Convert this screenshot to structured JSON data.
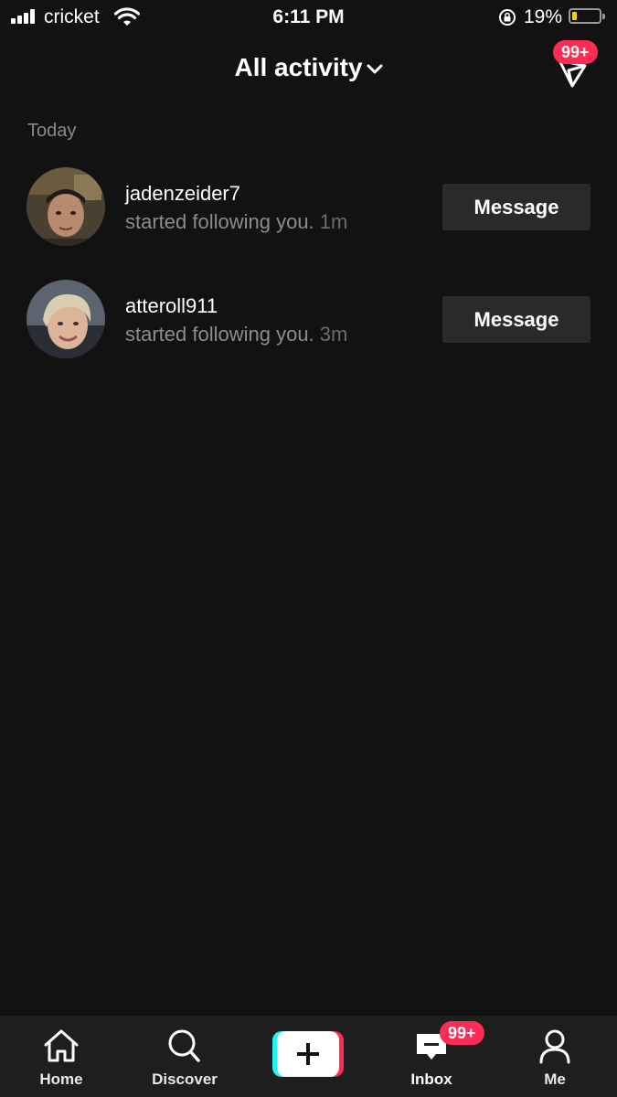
{
  "status_bar": {
    "carrier": "cricket",
    "time": "6:11 PM",
    "battery_percent": "19%",
    "battery_level": 0.19,
    "battery_color": "#f5d00f"
  },
  "header": {
    "title": "All activity",
    "title_icon": "chevron-down-icon",
    "dm_icon": "paper-plane-icon",
    "dm_badge": "99+"
  },
  "section": {
    "label": "Today"
  },
  "activities": [
    {
      "username": "jadenzeider7",
      "text": "started following you.",
      "time": "1m",
      "button_label": "Message"
    },
    {
      "username": "atteroll911",
      "text": "started following you.",
      "time": "3m",
      "button_label": "Message"
    }
  ],
  "tab_bar": {
    "tabs": [
      {
        "label": "Home",
        "icon": "home-icon"
      },
      {
        "label": "Discover",
        "icon": "search-icon"
      },
      {
        "label": "Inbox",
        "icon": "inbox-icon"
      },
      {
        "label": "Me",
        "icon": "person-icon"
      }
    ],
    "create_icon": "plus-icon",
    "inbox_badge": "99+"
  },
  "colors": {
    "background": "#121212",
    "badge": "#fe2c55",
    "accent_cyan": "#25f4ee",
    "button_bg": "#2a2a2a"
  }
}
